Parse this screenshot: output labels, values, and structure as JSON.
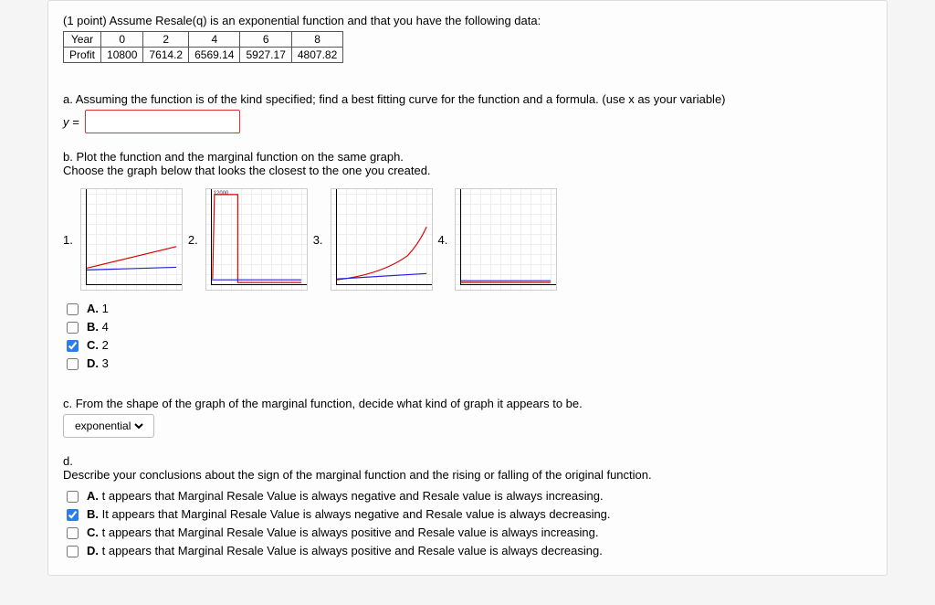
{
  "header": {
    "points_prefix": "(1 point) ",
    "prompt": "Assume Resale(q) is an exponential function and that you have the following data:"
  },
  "table": {
    "row1_label": "Year",
    "row2_label": "Profit",
    "years": [
      "0",
      "2",
      "4",
      "6",
      "8"
    ],
    "profits": [
      "10800",
      "7614.2",
      "6569.14",
      "5927.17",
      "4807.82"
    ]
  },
  "partA": {
    "text": "a. Assuming the function is of the kind specified; find a best fitting curve for the function and a formula. (use x as your variable)",
    "lhs": "y ="
  },
  "partB": {
    "line1": "b. Plot the function and the marginal function on the same graph.",
    "line2": "Choose the graph below that looks the closest to the one you created.",
    "labels": [
      "1.",
      "2.",
      "3.",
      "4."
    ],
    "choices": [
      {
        "letter": "A.",
        "value": "1",
        "checked": false
      },
      {
        "letter": "B.",
        "value": "4",
        "checked": false
      },
      {
        "letter": "C.",
        "value": "2",
        "checked": true
      },
      {
        "letter": "D.",
        "value": "3",
        "checked": false
      }
    ]
  },
  "partC": {
    "text": "c. From the shape of the graph of the marginal function, decide what kind of graph it appears to be.",
    "selected": "exponential"
  },
  "partD": {
    "heading": "d.",
    "text": "Describe your conclusions about the sign of the marginal function and the rising or falling of the original function.",
    "choices": [
      {
        "letter": "A.",
        "text": "t appears that Marginal Resale Value is always negative and Resale value is always increasing.",
        "checked": false
      },
      {
        "letter": "B.",
        "text": "It appears that Marginal Resale Value is always negative and Resale value is always decreasing.",
        "checked": true
      },
      {
        "letter": "C.",
        "text": "t appears that Marginal Resale Value is always positive and Resale value is always increasing.",
        "checked": false
      },
      {
        "letter": "D.",
        "text": "t appears that Marginal Resale Value is always positive and Resale value is always decreasing.",
        "checked": false
      }
    ]
  },
  "chart_data": [
    {
      "id": 1,
      "type": "line",
      "series": [
        {
          "name": "red",
          "color": "#d00",
          "points": [
            [
              0,
              0.2
            ],
            [
              1,
              0.42
            ]
          ]
        },
        {
          "name": "blue",
          "color": "#22d",
          "points": [
            [
              0,
              0.18
            ],
            [
              1,
              0.21
            ]
          ]
        }
      ]
    },
    {
      "id": 2,
      "type": "line",
      "series": [
        {
          "name": "red",
          "color": "#d00",
          "points": [
            [
              0.02,
              0.05
            ],
            [
              0.05,
              0.99
            ],
            [
              0.3,
              0.99
            ],
            [
              0.3,
              0.02
            ],
            [
              1,
              0.02
            ]
          ]
        },
        {
          "name": "blue",
          "color": "#22d",
          "points": [
            [
              0,
              0.05
            ],
            [
              1,
              0.05
            ]
          ]
        }
      ]
    },
    {
      "id": 3,
      "type": "line",
      "series": [
        {
          "name": "red",
          "color": "#d00",
          "points": [
            [
              0,
              0.05
            ],
            [
              0.5,
              0.12
            ],
            [
              0.8,
              0.3
            ],
            [
              1,
              0.6
            ]
          ]
        },
        {
          "name": "blue",
          "color": "#22d",
          "points": [
            [
              0,
              0.06
            ],
            [
              1,
              0.12
            ]
          ]
        }
      ]
    },
    {
      "id": 4,
      "type": "line",
      "series": [
        {
          "name": "red",
          "color": "#d00",
          "points": [
            [
              0,
              0.03
            ],
            [
              1,
              0.03
            ]
          ]
        },
        {
          "name": "blue",
          "color": "#22d",
          "points": [
            [
              0,
              0.04
            ],
            [
              1,
              0.04
            ]
          ]
        }
      ]
    }
  ]
}
